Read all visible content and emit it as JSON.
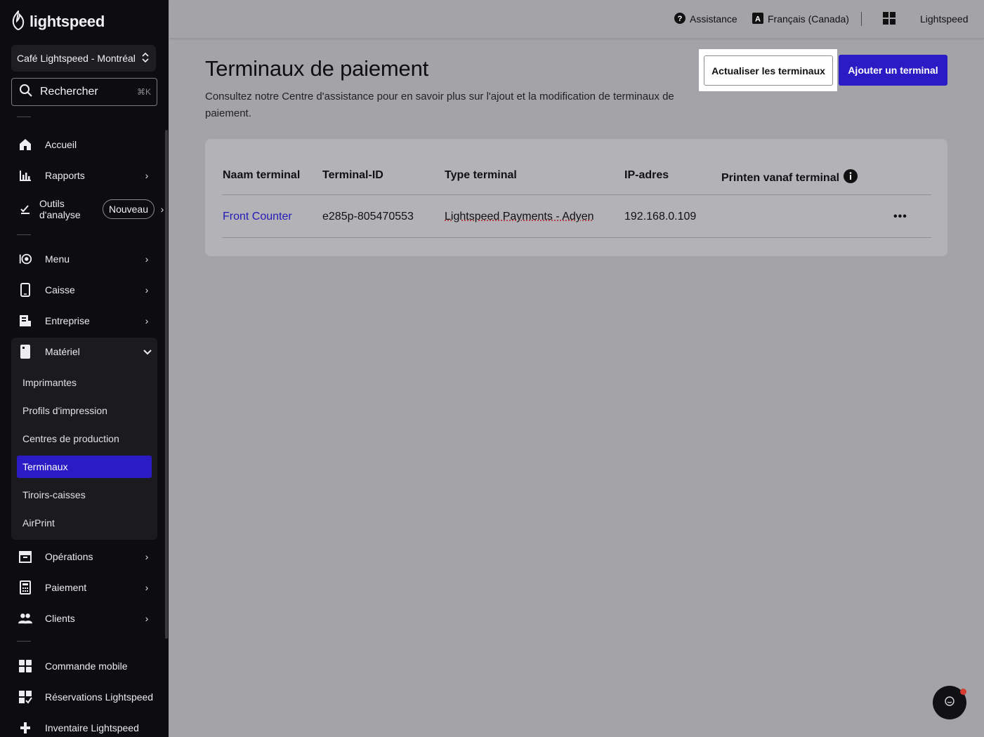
{
  "sidebar": {
    "brand": "lightspeed",
    "location": "Café Lightspeed - Montréal",
    "search": {
      "label": "Rechercher",
      "shortcut": "⌘K"
    },
    "items": [
      {
        "label": "Accueil"
      },
      {
        "label": "Rapports"
      },
      {
        "label": "Outils d'analyse",
        "badge": "Nouveau"
      },
      {
        "label": "Menu"
      },
      {
        "label": "Caisse"
      },
      {
        "label": "Entreprise"
      },
      {
        "label": "Matériel"
      },
      {
        "label": "Opérations"
      },
      {
        "label": "Paiement"
      },
      {
        "label": "Clients"
      },
      {
        "label": "Commande mobile"
      },
      {
        "label": "Réservations Lightspeed"
      },
      {
        "label": "Inventaire Lightspeed"
      }
    ],
    "analytics_line1": "Outils",
    "analytics_line2": "d'analyse",
    "submenu": [
      "Imprimantes",
      "Profils d'impression",
      "Centres de production",
      "Terminaux",
      "Tiroirs-caisses",
      "AirPrint"
    ],
    "active_submenu": "Terminaux"
  },
  "topbar": {
    "help": "Assistance",
    "language": "Français (Canada)",
    "account": "Lightspeed"
  },
  "page": {
    "title": "Terminaux de paiement",
    "subtitle": "Consultez notre Centre d'assistance pour en savoir plus sur l'ajout et la modification de terminaux de paiement.",
    "refresh_button": "Actualiser les terminaux",
    "add_button": "Ajouter un terminal"
  },
  "table": {
    "columns": [
      "Naam terminal",
      "Terminal-ID",
      "Type terminal",
      "IP-adres",
      "Printen vanaf terminal"
    ],
    "rows": [
      {
        "name": "Front Counter",
        "id": "e285p-805470553",
        "type": "Lightspeed Payments - Adyen",
        "ip": "192.168.0.109",
        "print": ""
      }
    ]
  },
  "colors": {
    "accent": "#2a1bc4",
    "sidebar_bg": "#0d0d0f",
    "overlay": "#a3a3a8"
  }
}
